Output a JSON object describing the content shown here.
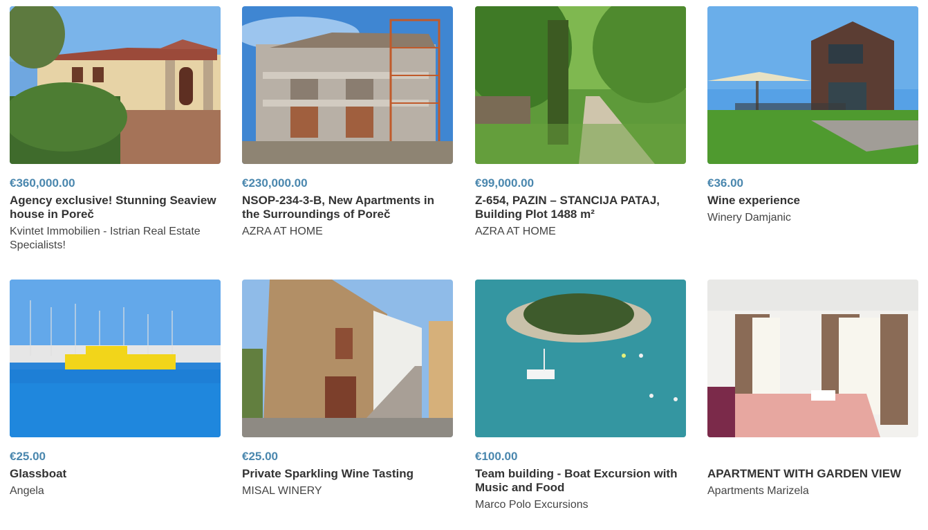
{
  "listings": [
    {
      "price": "€360,000.00",
      "title": "Agency exclusive! Stunning Seaview house in Poreč",
      "seller": "Kvintet Immobilien - Istrian Real Estate Specialists!",
      "image": "house-photo"
    },
    {
      "price": "€230,000.00",
      "title": "NSOP-234-3-B, New Apartments in the Surroundings of Poreč",
      "seller": "AZRA AT HOME",
      "image": "construction-photo"
    },
    {
      "price": "€99,000.00",
      "title": "Z-654, PAZIN – STANCIJA PATAJ, Building Plot 1488 m²",
      "seller": "AZRA AT HOME",
      "image": "forest-path-photo"
    },
    {
      "price": "€36.00",
      "title": "Wine experience",
      "seller": "Winery Damjanic",
      "image": "winery-photo"
    },
    {
      "price": "€25.00",
      "title": "Glassboat",
      "seller": "Angela",
      "image": "glassboat-photo"
    },
    {
      "price": "€25.00",
      "title": "Private Sparkling Wine Tasting",
      "seller": "MISAL WINERY",
      "image": "stone-house-photo"
    },
    {
      "price": "€100.00",
      "title": "Team building - Boat Excursion with Music and Food",
      "seller": "Marco Polo Excursions",
      "image": "island-photo"
    },
    {
      "price": "",
      "title": "APARTMENT WITH GARDEN VIEW",
      "seller": "Apartments Marizela",
      "image": "bedroom-photo"
    }
  ]
}
